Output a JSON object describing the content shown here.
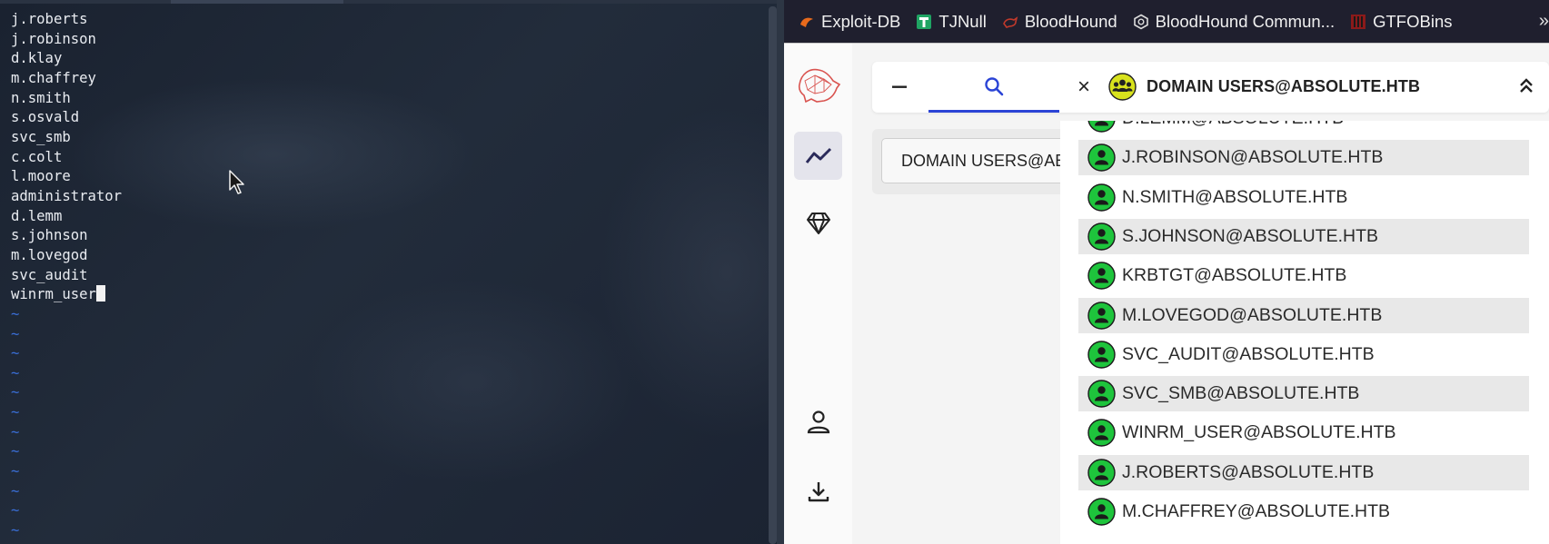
{
  "terminal": {
    "lines": [
      "j.roberts",
      "j.robinson",
      "d.klay",
      "m.chaffrey",
      "n.smith",
      "s.osvald",
      "svc_smb",
      "c.colt",
      "l.moore",
      "administrator",
      "d.lemm",
      "s.johnson",
      "m.lovegod",
      "svc_audit",
      "winrm_user"
    ],
    "empty_line_marker": "~",
    "empty_line_count": 12,
    "text_color": "#e9ecf1",
    "tilde_color": "#3a6fd8"
  },
  "bookmarks": {
    "items": [
      {
        "label": "Exploit-DB",
        "icon": "exploit-db-icon"
      },
      {
        "label": "TJNull",
        "icon": "tjnull-icon"
      },
      {
        "label": "BloodHound",
        "icon": "bloodhound-icon"
      },
      {
        "label": "BloodHound Commun...",
        "icon": "bloodhound-community-icon"
      },
      {
        "label": "GTFOBins",
        "icon": "gtfobins-icon"
      }
    ],
    "overflow_label": "»"
  },
  "bloodhound": {
    "accent_color": "#2b44d6",
    "search": {
      "minus_label": "−",
      "close_label": "×",
      "group_name": "DOMAIN USERS@ABSOLUTE.HTB"
    },
    "result_chip": "DOMAIN USERS@ABSOLUTE.HTB",
    "members": [
      "D.LEMM@ABSOLUTE.HTB",
      "J.ROBINSON@ABSOLUTE.HTB",
      "N.SMITH@ABSOLUTE.HTB",
      "S.JOHNSON@ABSOLUTE.HTB",
      "KRBTGT@ABSOLUTE.HTB",
      "M.LOVEGOD@ABSOLUTE.HTB",
      "SVC_AUDIT@ABSOLUTE.HTB",
      "SVC_SMB@ABSOLUTE.HTB",
      "WINRM_USER@ABSOLUTE.HTB",
      "J.ROBERTS@ABSOLUTE.HTB",
      "M.CHAFFREY@ABSOLUTE.HTB"
    ]
  }
}
